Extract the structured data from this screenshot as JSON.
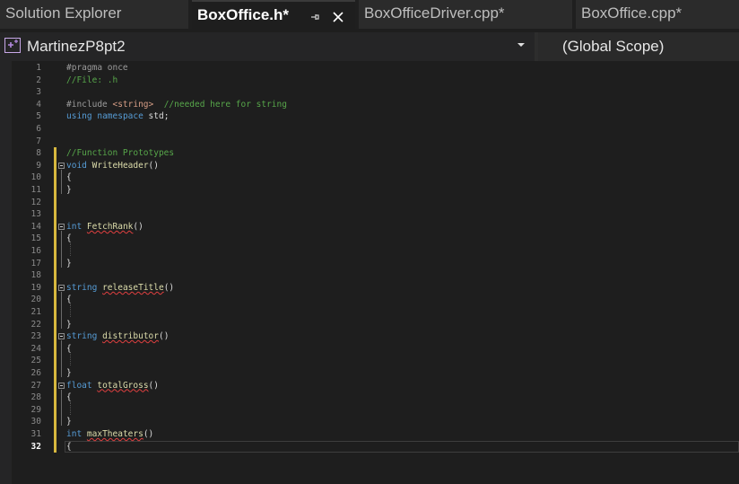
{
  "tabs": [
    {
      "label": "Solution Explorer",
      "active": false
    },
    {
      "label": "BoxOffice.h*",
      "active": true
    },
    {
      "label": "BoxOfficeDriver.cpp*",
      "active": false
    },
    {
      "label": "BoxOffice.cpp*",
      "active": false
    }
  ],
  "tab_icons": {
    "pin": "pin-icon",
    "close": "close-icon"
  },
  "navbar": {
    "project": "MartinezP8pt2",
    "scope": "(Global Scope)",
    "project_icon": "project-icon",
    "dropdown_icon": "dropdown-arrow-icon"
  },
  "editor": {
    "current_line": 32,
    "lines": [
      {
        "n": "1",
        "segs": [
          {
            "c": "pp",
            "t": "#pragma once"
          }
        ]
      },
      {
        "n": "2",
        "segs": [
          {
            "c": "cm",
            "t": "//File: .h"
          }
        ]
      },
      {
        "n": "3",
        "segs": []
      },
      {
        "n": "4",
        "segs": [
          {
            "c": "pp",
            "t": "#include "
          },
          {
            "c": "st",
            "t": "<string>"
          },
          {
            "c": "",
            "t": "  "
          },
          {
            "c": "cm",
            "t": "//needed here for string"
          }
        ]
      },
      {
        "n": "5",
        "segs": [
          {
            "c": "kw",
            "t": "using"
          },
          {
            "c": "",
            "t": " "
          },
          {
            "c": "kw",
            "t": "namespace"
          },
          {
            "c": "",
            "t": " std;"
          }
        ]
      },
      {
        "n": "6",
        "segs": []
      },
      {
        "n": "7",
        "segs": []
      },
      {
        "n": "8",
        "segs": [
          {
            "c": "cm",
            "t": "//Function Prototypes"
          }
        ]
      },
      {
        "n": "9",
        "segs": [
          {
            "c": "kw",
            "t": "void"
          },
          {
            "c": "",
            "t": " "
          },
          {
            "c": "fn-plain",
            "t": "WriteHeader"
          },
          {
            "c": "",
            "t": "()"
          }
        ]
      },
      {
        "n": "10",
        "segs": [
          {
            "c": "",
            "t": "{"
          }
        ]
      },
      {
        "n": "11",
        "segs": [
          {
            "c": "",
            "t": "}"
          }
        ]
      },
      {
        "n": "12",
        "segs": []
      },
      {
        "n": "13",
        "segs": []
      },
      {
        "n": "14",
        "segs": [
          {
            "c": "kw",
            "t": "int"
          },
          {
            "c": "",
            "t": " "
          },
          {
            "c": "fn",
            "t": "FetchRank"
          },
          {
            "c": "",
            "t": "()"
          }
        ]
      },
      {
        "n": "15",
        "segs": [
          {
            "c": "",
            "t": "{"
          }
        ]
      },
      {
        "n": "16",
        "segs": []
      },
      {
        "n": "17",
        "segs": [
          {
            "c": "",
            "t": "}"
          }
        ]
      },
      {
        "n": "18",
        "segs": []
      },
      {
        "n": "19",
        "segs": [
          {
            "c": "kw",
            "t": "string"
          },
          {
            "c": "",
            "t": " "
          },
          {
            "c": "fn",
            "t": "releaseTitle"
          },
          {
            "c": "",
            "t": "()"
          }
        ]
      },
      {
        "n": "20",
        "segs": [
          {
            "c": "",
            "t": "{"
          }
        ]
      },
      {
        "n": "21",
        "segs": []
      },
      {
        "n": "22",
        "segs": [
          {
            "c": "",
            "t": "}"
          }
        ]
      },
      {
        "n": "23",
        "segs": [
          {
            "c": "kw",
            "t": "string"
          },
          {
            "c": "",
            "t": " "
          },
          {
            "c": "fn",
            "t": "distributor"
          },
          {
            "c": "",
            "t": "()"
          }
        ]
      },
      {
        "n": "24",
        "segs": [
          {
            "c": "",
            "t": "{"
          }
        ]
      },
      {
        "n": "25",
        "segs": []
      },
      {
        "n": "26",
        "segs": [
          {
            "c": "",
            "t": "}"
          }
        ]
      },
      {
        "n": "27",
        "segs": [
          {
            "c": "kw",
            "t": "float"
          },
          {
            "c": "",
            "t": " "
          },
          {
            "c": "fn",
            "t": "totalGross"
          },
          {
            "c": "",
            "t": "()"
          }
        ]
      },
      {
        "n": "28",
        "segs": [
          {
            "c": "",
            "t": "{"
          }
        ]
      },
      {
        "n": "29",
        "segs": []
      },
      {
        "n": "30",
        "segs": [
          {
            "c": "",
            "t": "}"
          }
        ]
      },
      {
        "n": "31",
        "segs": [
          {
            "c": "kw",
            "t": "int"
          },
          {
            "c": "",
            "t": " "
          },
          {
            "c": "fn",
            "t": "maxTheaters"
          },
          {
            "c": "",
            "t": "()"
          }
        ]
      },
      {
        "n": "32",
        "segs": [
          {
            "c": "",
            "t": "{"
          }
        ]
      }
    ]
  }
}
